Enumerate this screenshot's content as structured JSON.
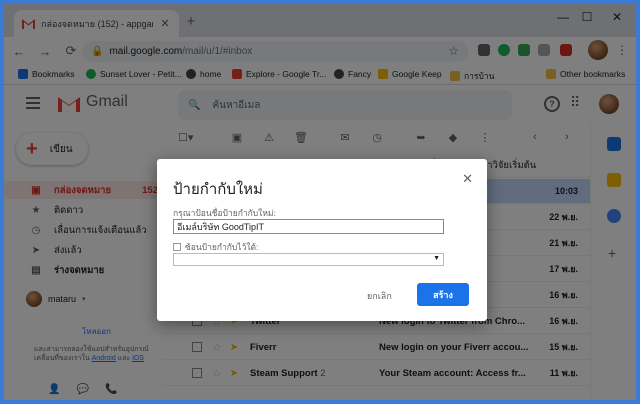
{
  "browser": {
    "tab_title": "กล่องจดหมาย (152) - appgamemu",
    "new_tab": "+",
    "url_host": "mail.google.com",
    "url_path": "/mail/u/1/#inbox",
    "back": "←",
    "forward": "→",
    "reload": "⟳",
    "star": "☆",
    "minimize": "—",
    "maximize": "☐",
    "close": "✕",
    "tab_close": "✕"
  },
  "bookmarks": [
    {
      "label": "Bookmarks",
      "color": "#1a73e8"
    },
    {
      "label": "Sunset Lover - Petit...",
      "color": "#1db954"
    },
    {
      "label": "home",
      "color": "#444"
    },
    {
      "label": "Explore - Google Tr...",
      "color": "#ea4335"
    },
    {
      "label": "Fancy",
      "color": "#444"
    },
    {
      "label": "Google Keep",
      "color": "#fbbc04"
    },
    {
      "label": "การบ้าน",
      "color": "#f5c242"
    }
  ],
  "other_bookmarks": "Other bookmarks",
  "gmail": {
    "logo": "Gmail",
    "search_placeholder": "ค้นหาอีเมล",
    "help": "?"
  },
  "sidebar": {
    "compose": "เขียน",
    "items": [
      {
        "label": "กล่องจดหมาย",
        "icon": "inbox-icon",
        "glyph": "▣",
        "count": "152"
      },
      {
        "label": "ติดดาว",
        "icon": "star-icon",
        "glyph": "★",
        "count": ""
      },
      {
        "label": "เลื่อนการแจ้งเตือนแล้ว",
        "icon": "clock-icon",
        "glyph": "◷",
        "count": ""
      },
      {
        "label": "ส่งแล้ว",
        "icon": "send-icon",
        "glyph": "➤",
        "count": ""
      },
      {
        "label": "ร่างจดหมาย",
        "icon": "draft-icon",
        "glyph": "▤",
        "count": ""
      }
    ],
    "user": "mataru",
    "signout": "โหลออก",
    "app_note": "และสามารถลองใช้แอปสำหรับอุปกรณ์เคลื่อนที่ของเราใน",
    "android": "Android",
    "and": "และ",
    "ios": "iOS"
  },
  "emails": [
    {
      "from": "",
      "subject": "ร่วมสมัครลงชื่อในการศึกษาวิจัยเริ่มต้น",
      "date": ""
    },
    {
      "from": "",
      "subject": "...0 - ข...",
      "date": "10:03"
    },
    {
      "from": "",
      "subject": "...mu...",
      "date": "22 พ.ย."
    },
    {
      "from": "",
      "subject": "...n Det...",
      "date": "21 พ.ย."
    },
    {
      "from": "",
      "subject": "...mu...",
      "date": "17 พ.ย."
    },
    {
      "from": "",
      "subject": "...h Sus...",
      "date": "16 พ.ย."
    },
    {
      "from": "Twitter",
      "subject": "New login to Twitter from Chro...",
      "date": "16 พ.ย."
    },
    {
      "from": "Fiverr",
      "subject": "New login on your Fiverr accou...",
      "date": "15 พ.ย."
    },
    {
      "from": "Steam Support",
      "count": "2",
      "subject": "Your Steam account: Access fr...",
      "date": "11 พ.ย."
    }
  ],
  "dialog": {
    "title": "ป้ายกำกับใหม่",
    "prompt": "กรุณาป้อนชื่อป้ายกำกับใหม่:",
    "value": "อีเมล์บริษัท GoodTipIT",
    "nest": "ซ้อนป้ายกำกับไว้ใต้:",
    "cancel": "ยกเลิก",
    "create": "สร้าง",
    "close": "✕"
  }
}
